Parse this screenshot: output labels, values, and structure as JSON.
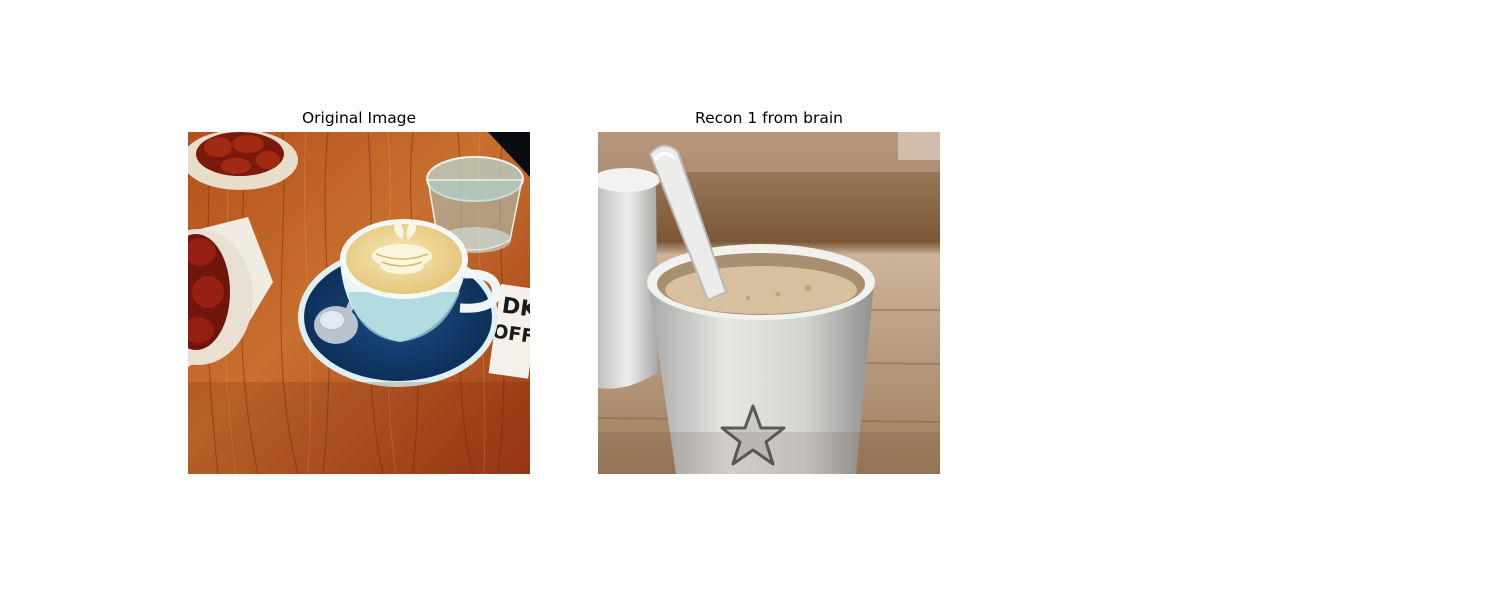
{
  "panels": [
    {
      "title": "Original Image",
      "image": "latte-art-cup-on-wooden-table"
    },
    {
      "title": "Recon 1 from brain",
      "image": "white-mug-with-spoon-and-star"
    }
  ],
  "cup_sign_text": "DK COFFEE"
}
